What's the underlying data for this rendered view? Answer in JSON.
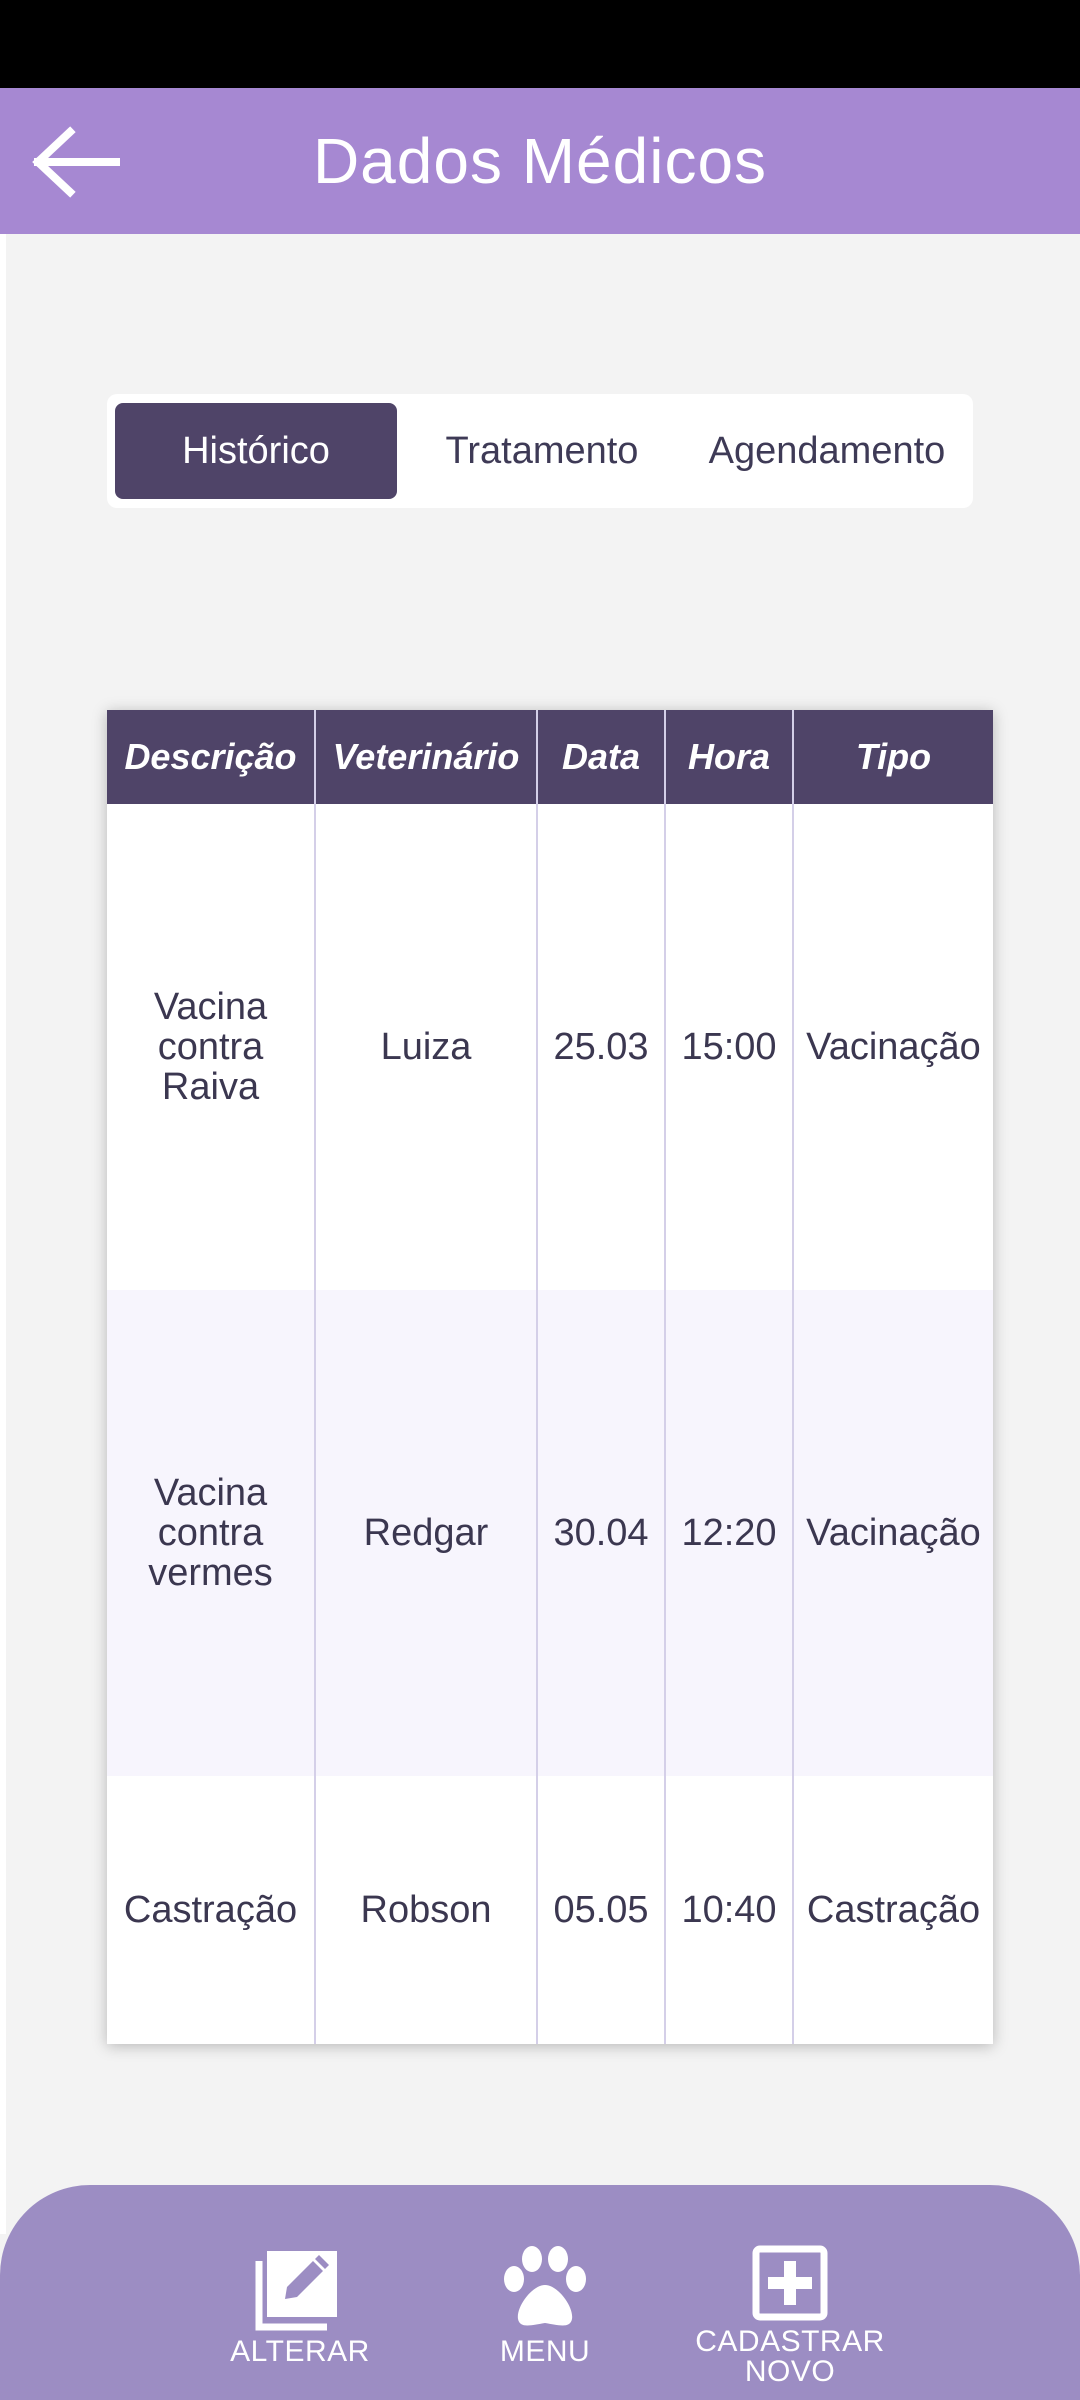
{
  "header": {
    "title": "Dados Médicos",
    "back_icon": "arrow-left-icon"
  },
  "tabs": [
    {
      "label": "Histórico",
      "active": true
    },
    {
      "label": "Tratamento",
      "active": false
    },
    {
      "label": "Agendamento",
      "active": false
    }
  ],
  "table": {
    "columns": [
      "Descrição",
      "Veterinário",
      "Data",
      "Hora",
      "Tipo"
    ],
    "rows": [
      {
        "descricao": "Vacina contra Raiva",
        "veterinario": "Luiza",
        "data": "25.03",
        "hora": "15:00",
        "tipo": "Vacinação"
      },
      {
        "descricao": "Vacina contra vermes",
        "veterinario": "Redgar",
        "data": "30.04",
        "hora": "12:20",
        "tipo": "Vacinação"
      },
      {
        "descricao": "Castração",
        "veterinario": "Robson",
        "data": "05.05",
        "hora": "10:40",
        "tipo": "Castração"
      }
    ]
  },
  "bottom_nav": {
    "alterar": {
      "label": "ALTERAR",
      "icon": "edit-icon"
    },
    "menu": {
      "label": "MENU",
      "icon": "paw-icon"
    },
    "cadastrar": {
      "label": "CADASTRAR NOVO",
      "icon": "add-square-icon"
    }
  },
  "colors": {
    "app_bar": "#a688d2",
    "header_dark": "#4f4468",
    "bottom_nav": "#9c8dc3",
    "alt_row": "#f7f5fd"
  }
}
